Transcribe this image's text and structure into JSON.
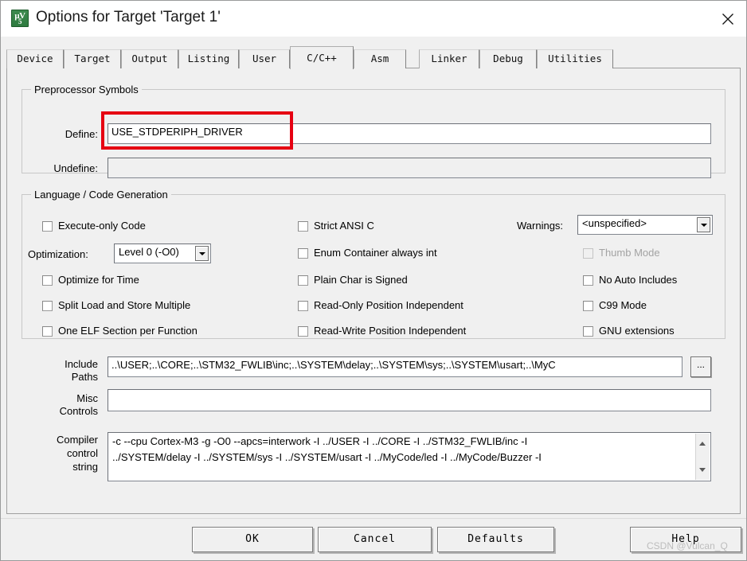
{
  "window": {
    "title": "Options for Target 'Target 1'",
    "icon": "keil-uvision-icon",
    "icon_line1": "μV",
    "icon_line2": "5",
    "close_icon": "close-icon"
  },
  "tabs": [
    {
      "label": "Device",
      "active": false
    },
    {
      "label": "Target",
      "active": false
    },
    {
      "label": "Output",
      "active": false
    },
    {
      "label": "Listing",
      "active": false
    },
    {
      "label": "User",
      "active": false
    },
    {
      "label": "C/C++",
      "active": true
    },
    {
      "label": "Asm",
      "active": false
    },
    {
      "label": "Linker",
      "active": false
    },
    {
      "label": "Debug",
      "active": false
    },
    {
      "label": "Utilities",
      "active": false
    }
  ],
  "preprocessor": {
    "group_title": "Preprocessor Symbols",
    "define_label": "Define:",
    "define_value": "USE_STDPERIPH_DRIVER",
    "undefine_label": "Undefine:",
    "undefine_value": ""
  },
  "language": {
    "group_title": "Language / Code Generation",
    "col1": [
      {
        "label": "Execute-only Code",
        "checked": false,
        "enabled": true
      },
      {
        "label": "Optimize for Time",
        "checked": false,
        "enabled": true
      },
      {
        "label": "Split Load and Store Multiple",
        "checked": false,
        "enabled": true
      },
      {
        "label": "One ELF Section per Function",
        "checked": false,
        "enabled": true
      }
    ],
    "col2": [
      {
        "label": "Strict ANSI C",
        "checked": false,
        "enabled": true
      },
      {
        "label": "Enum Container always int",
        "checked": false,
        "enabled": true
      },
      {
        "label": "Plain Char is Signed",
        "checked": false,
        "enabled": true
      },
      {
        "label": "Read-Only Position Independent",
        "checked": false,
        "enabled": true
      },
      {
        "label": "Read-Write Position Independent",
        "checked": false,
        "enabled": true
      }
    ],
    "col3": [
      {
        "label": "Thumb Mode",
        "checked": false,
        "enabled": false
      },
      {
        "label": "No Auto Includes",
        "checked": false,
        "enabled": true
      },
      {
        "label": "C99 Mode",
        "checked": false,
        "enabled": true
      },
      {
        "label": "GNU extensions",
        "checked": false,
        "enabled": true
      }
    ],
    "optimization_label": "Optimization:",
    "optimization_value": "Level 0 (-O0)",
    "warnings_label": "Warnings:",
    "warnings_value": "<unspecified>"
  },
  "paths": {
    "include_label_l1": "Include",
    "include_label_l2": "Paths",
    "include_value": "..\\USER;..\\CORE;..\\STM32_FWLIB\\inc;..\\SYSTEM\\delay;..\\SYSTEM\\sys;..\\SYSTEM\\usart;..\\MyC",
    "browse_label": "...",
    "misc_label_l1": "Misc",
    "misc_label_l2": "Controls",
    "misc_value": "",
    "compiler_label_l1": "Compiler",
    "compiler_label_l2": "control",
    "compiler_label_l3": "string",
    "compiler_line1": "-c --cpu Cortex-M3 -g -O0 --apcs=interwork -I ../USER -I ../CORE -I ../STM32_FWLIB/inc -I",
    "compiler_line2": "../SYSTEM/delay -I ../SYSTEM/sys -I ../SYSTEM/usart -I ../MyCode/led -I ../MyCode/Buzzer -I",
    "scroll_up_icon": "chevron-up-icon",
    "scroll_down_icon": "chevron-down-icon"
  },
  "footer": {
    "ok_label": "OK",
    "cancel_label": "Cancel",
    "defaults_label": "Defaults",
    "help_label": "Help"
  },
  "watermark": {
    "text": "CSDN @Vulcan_Q"
  },
  "colors": {
    "highlight": "#e60012",
    "dialog_bg": "#f0f0f0",
    "field_bg": "#ffffff",
    "disabled_text": "#a3a3a3"
  }
}
